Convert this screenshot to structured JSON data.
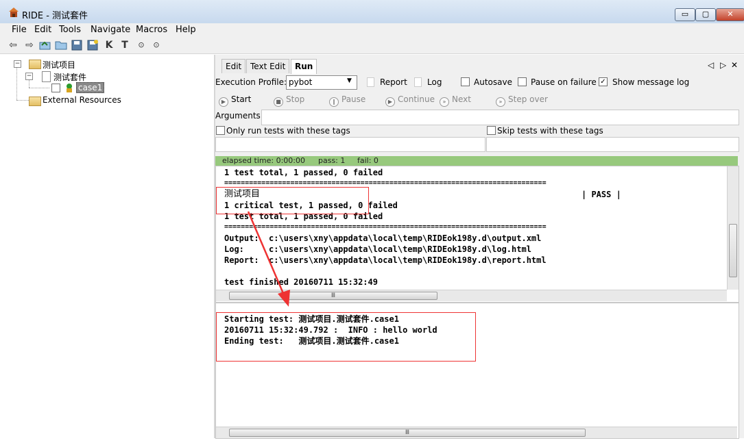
{
  "window": {
    "title": "RIDE - 测试套件",
    "min": "▭",
    "max": "▢",
    "close": "✕"
  },
  "menu": [
    "File",
    "Edit",
    "Tools",
    "Navigate",
    "Macros",
    "Help"
  ],
  "toolbar_icons": [
    "arrow-left-icon",
    "arrow-right-icon",
    "open-folder-icon",
    "folder-icon",
    "save-icon",
    "save-all-icon",
    "keyword-search-icon",
    "test-search-icon",
    "run-icon",
    "stop-icon"
  ],
  "tree": {
    "root": "测试项目",
    "suite": "测试套件",
    "case": "case1",
    "external": "External Resources"
  },
  "tabs": [
    "Edit",
    "Text Edit",
    "Run"
  ],
  "tab_nav": {
    "prev": "◁",
    "next": "▷",
    "close": "✕"
  },
  "run": {
    "profile_label": "Execution Profile:",
    "profile_value": "pybot",
    "report": "Report",
    "log": "Log",
    "autosave": "Autosave",
    "pause_on_failure": "Pause on failure",
    "show_message_log": "Show message log",
    "buttons": {
      "start": "Start",
      "stop": "Stop",
      "pause": "Pause",
      "continue": "Continue",
      "next": "Next",
      "step_over": "Step over"
    },
    "arguments_label": "Arguments:",
    "only_run_tags": "Only run tests with these tags",
    "skip_tags": "Skip tests with these tags"
  },
  "status": {
    "elapsed": "elapsed time: 0:00:00",
    "pass": "pass: 1",
    "fail": "fail: 0",
    "color": "#97c97d"
  },
  "output": {
    "l1": "1 test total, 1 passed, 0 failed",
    "sep1": "==============================================================================",
    "suite_name": "测试项目",
    "suite_status": "| PASS |",
    "l3": "1 critical test, 1 passed, 0 failed",
    "l4": "1 test total, 1 passed, 0 failed",
    "sep2": "==============================================================================",
    "output_line": "Output:  c:\\users\\xny\\appdata\\local\\temp\\RIDEok198y.d\\output.xml",
    "log_line": "Log:     c:\\users\\xny\\appdata\\local\\temp\\RIDEok198y.d\\log.html",
    "report_line": "Report:  c:\\users\\xny\\appdata\\local\\temp\\RIDEok198y.d\\report.html",
    "finished": "test finished 20160711 15:32:49"
  },
  "message_log": {
    "m1": "Starting test: 测试项目.测试套件.case1",
    "m2": "20160711 15:32:49.792 :  INFO : hello world",
    "m3": "Ending test:   测试项目.测试套件.case1"
  },
  "scroll_thumb": "Ⅲ",
  "annotation_color": "#e33"
}
